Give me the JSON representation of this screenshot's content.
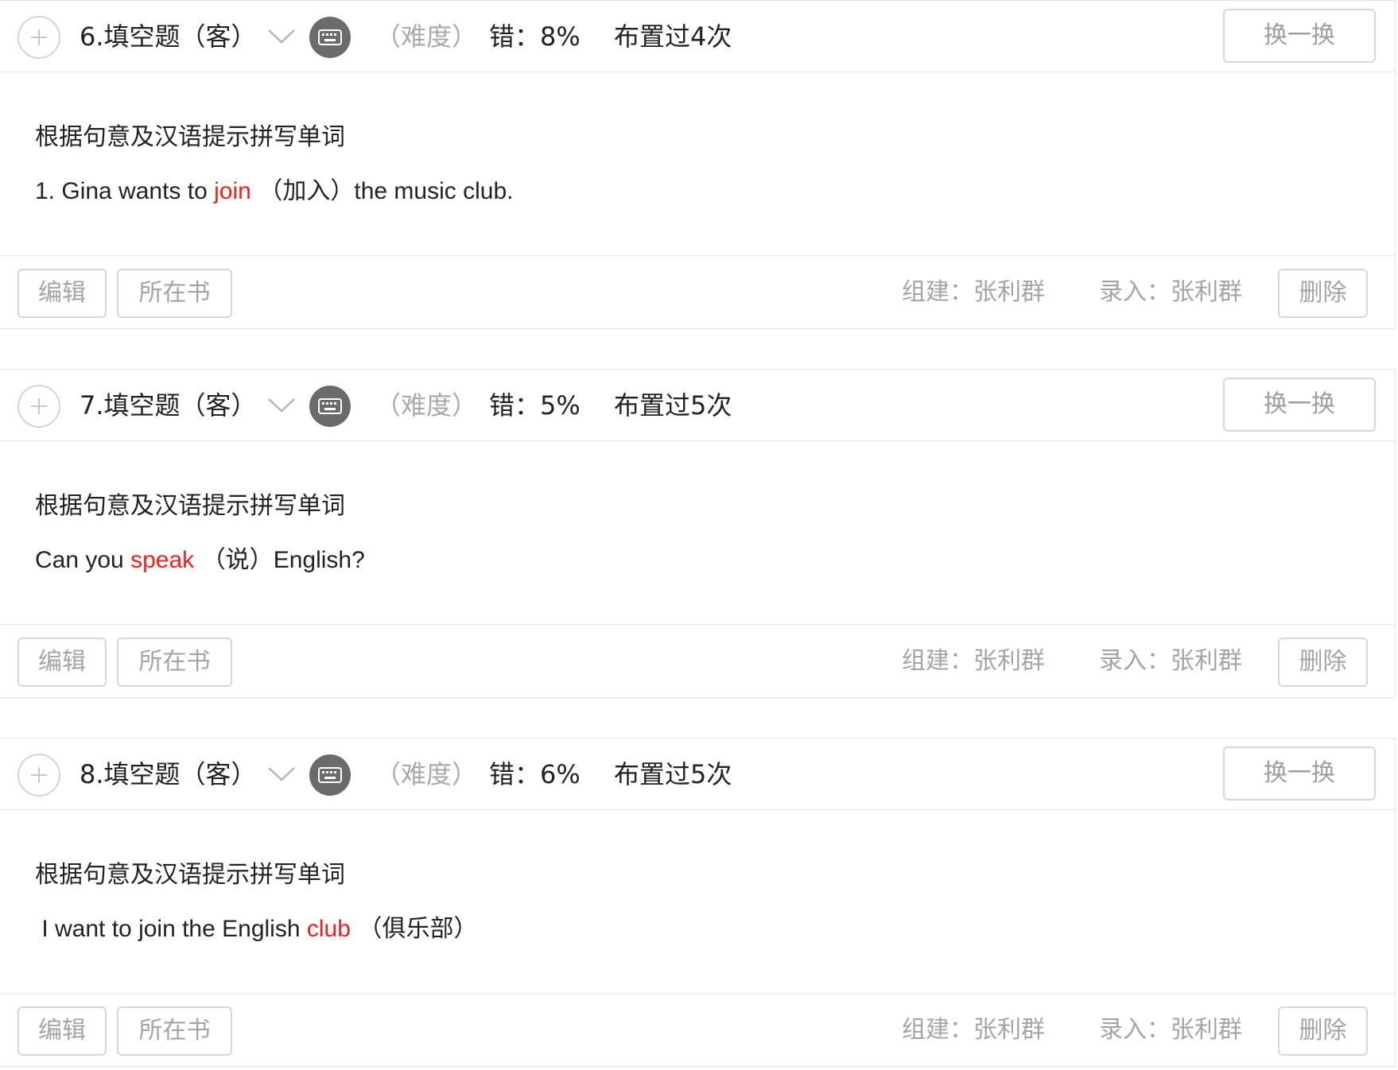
{
  "questions": [
    {
      "title": "6.填空题（客）",
      "difficulty": "（难度）",
      "error_rate": "错：8%",
      "assigned": "布置过4次",
      "swap_label": "换一换",
      "instruction": "根据句意及汉语提示拼写单词",
      "sentence": {
        "before": "1. Gina wants to ",
        "answer": "join",
        "hint": " （加入）",
        "after": "the music club."
      },
      "edit_label": "编辑",
      "book_label": "所在书",
      "builder": "组建：张利群",
      "entry": "录入：张利群",
      "delete_label": "删除"
    },
    {
      "title": "7.填空题（客）",
      "difficulty": "（难度）",
      "error_rate": "错：5%",
      "assigned": "布置过5次",
      "swap_label": "换一换",
      "instruction": "根据句意及汉语提示拼写单词",
      "sentence": {
        "before": "Can you ",
        "answer": "speak",
        "hint": " （说）",
        "after": "English?"
      },
      "edit_label": "编辑",
      "book_label": "所在书",
      "builder": "组建：张利群",
      "entry": "录入：张利群",
      "delete_label": "删除"
    },
    {
      "title": "8.填空题（客）",
      "difficulty": "（难度）",
      "error_rate": "错：6%",
      "assigned": "布置过5次",
      "swap_label": "换一换",
      "instruction": "根据句意及汉语提示拼写单词",
      "sentence": {
        "before": " I want to join the English ",
        "answer": "club",
        "hint": " （俱乐部）",
        "after": ""
      },
      "edit_label": "编辑",
      "book_label": "所在书",
      "builder": "组建：张利群",
      "entry": "录入：张利群",
      "delete_label": "删除"
    }
  ],
  "icons": {
    "add": "plus-circle-icon",
    "expand": "chevron-down-icon",
    "type": "keyboard-icon"
  },
  "colors": {
    "answer": "#ff1a1a",
    "muted": "#a4a4a4",
    "border": "#e2e2e2",
    "icon_bg": "#6b6b6b"
  }
}
